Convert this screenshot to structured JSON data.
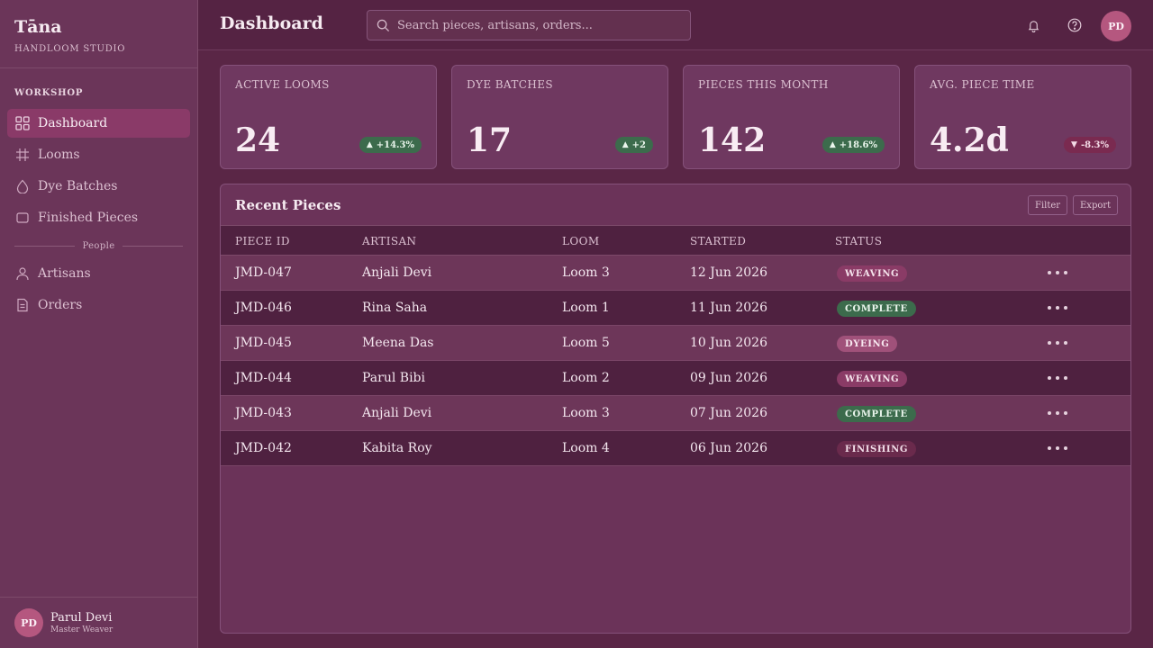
{
  "brand": {
    "name": "Tāna",
    "subtitle": "HANDLOOM STUDIO"
  },
  "sidebar": {
    "section_workshop": "WORKSHOP",
    "items": [
      {
        "label": "Dashboard",
        "icon": "grid-icon",
        "active": true
      },
      {
        "label": "Looms",
        "icon": "loom-grid-icon"
      },
      {
        "label": "Dye Batches",
        "icon": "droplet-icon"
      },
      {
        "label": "Finished Pieces",
        "icon": "square-icon"
      }
    ],
    "section_people": "People",
    "people_items": [
      {
        "label": "Artisans",
        "icon": "user-icon"
      },
      {
        "label": "Orders",
        "icon": "document-icon"
      }
    ],
    "user": {
      "initials": "PD",
      "name": "Parul Devi",
      "role": "Master Weaver"
    }
  },
  "header": {
    "title": "Dashboard",
    "search_placeholder": "Search pieces, artisans, orders...",
    "avatar_initials": "PD"
  },
  "stats": [
    {
      "label": "ACTIVE LOOMS",
      "value": "24",
      "delta": "+14.3%",
      "trend": "up"
    },
    {
      "label": "DYE BATCHES",
      "value": "17",
      "delta": "+2",
      "trend": "up"
    },
    {
      "label": "PIECES THIS MONTH",
      "value": "142",
      "delta": "+18.6%",
      "trend": "up"
    },
    {
      "label": "AVG. PIECE TIME",
      "value": "4.2d",
      "delta": "-8.3%",
      "trend": "down"
    }
  ],
  "panel": {
    "title": "Recent Pieces",
    "filter_label": "Filter",
    "export_label": "Export",
    "columns": [
      "PIECE ID",
      "ARTISAN",
      "LOOM",
      "STARTED",
      "STATUS"
    ],
    "rows": [
      {
        "id": "JMD-047",
        "artisan": "Anjali Devi",
        "loom": "Loom 3",
        "started": "12 Jun 2026",
        "status": "WEAVING"
      },
      {
        "id": "JMD-046",
        "artisan": "Rina Saha",
        "loom": "Loom 1",
        "started": "11 Jun 2026",
        "status": "COMPLETE"
      },
      {
        "id": "JMD-045",
        "artisan": "Meena Das",
        "loom": "Loom 5",
        "started": "10 Jun 2026",
        "status": "DYEING"
      },
      {
        "id": "JMD-044",
        "artisan": "Parul Bibi",
        "loom": "Loom 2",
        "started": "09 Jun 2026",
        "status": "WEAVING"
      },
      {
        "id": "JMD-043",
        "artisan": "Anjali Devi",
        "loom": "Loom 3",
        "started": "07 Jun 2026",
        "status": "COMPLETE"
      },
      {
        "id": "JMD-042",
        "artisan": "Kabita Roy",
        "loom": "Loom 4",
        "started": "06 Jun 2026",
        "status": "FINISHING"
      }
    ]
  },
  "colors": {
    "background": "#5a2646",
    "sidebar": "#6b3559",
    "accent": "#8a3a68",
    "positive": "#3c6b4c",
    "negative": "#7a2a50"
  }
}
